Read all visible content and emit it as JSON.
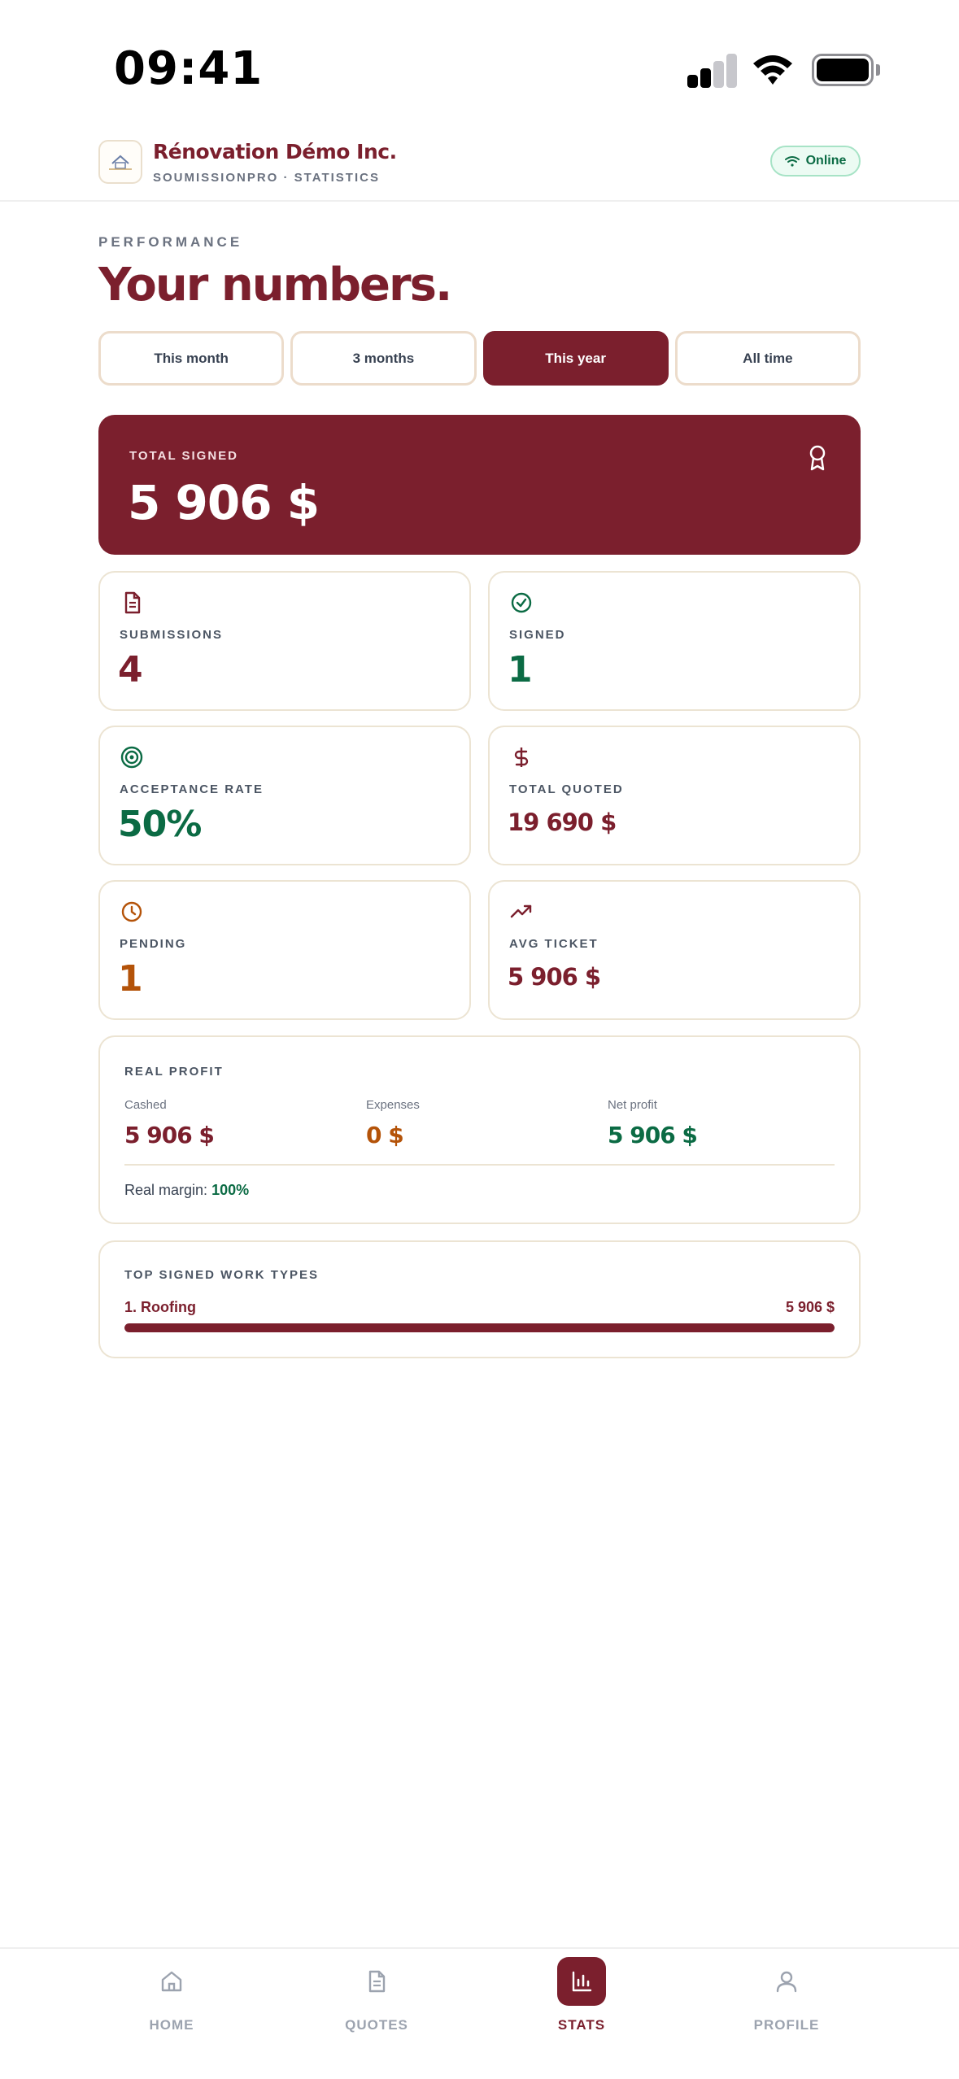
{
  "status_bar": {
    "time": "09:41"
  },
  "header": {
    "company_name": "Rénovation Démo Inc.",
    "subtitle": "SOUMISSIONPRO · STATISTICS",
    "status": "Online"
  },
  "page": {
    "eyebrow": "PERFORMANCE",
    "title": "Your numbers."
  },
  "period_tabs": [
    {
      "label": "This month",
      "active": false
    },
    {
      "label": "3 months",
      "active": false
    },
    {
      "label": "This year",
      "active": true
    },
    {
      "label": "All time",
      "active": false
    }
  ],
  "hero": {
    "label": "TOTAL SIGNED",
    "value": "5 906 $",
    "icon": "award-icon"
  },
  "stats": {
    "submissions": {
      "label": "SUBMISSIONS",
      "value": "4",
      "icon": "document-icon"
    },
    "signed": {
      "label": "SIGNED",
      "value": "1",
      "icon": "check-circle-icon"
    },
    "acceptance_rate": {
      "label": "ACCEPTANCE RATE",
      "value": "50%",
      "icon": "target-icon"
    },
    "total_quoted": {
      "label": "TOTAL QUOTED",
      "value": "19 690 $",
      "icon": "dollar-icon"
    },
    "pending": {
      "label": "PENDING",
      "value": "1",
      "icon": "clock-icon"
    },
    "avg_ticket": {
      "label": "AVG TICKET",
      "value": "5 906 $",
      "icon": "trending-up-icon"
    }
  },
  "profit": {
    "label": "REAL PROFIT",
    "cashed": {
      "label": "Cashed",
      "value": "5 906 $"
    },
    "expenses": {
      "label": "Expenses",
      "value": "0 $"
    },
    "net": {
      "label": "Net profit",
      "value": "5 906 $"
    },
    "margin_label": "Real margin:",
    "margin_value": "100%"
  },
  "work_types": {
    "label": "TOP SIGNED WORK TYPES",
    "items": [
      {
        "name": "1. Roofing",
        "amount": "5 906 $",
        "share": 1.0
      }
    ]
  },
  "bottom_nav": [
    {
      "label": "HOME",
      "icon": "home-icon",
      "active": false
    },
    {
      "label": "QUOTES",
      "icon": "document-icon",
      "active": false
    },
    {
      "label": "STATS",
      "icon": "bar-chart-icon",
      "active": true
    },
    {
      "label": "PROFILE",
      "icon": "user-icon",
      "active": false
    }
  ],
  "colors": {
    "brand": "#7b1f2d",
    "success": "#0b6b44",
    "warning": "#b45309",
    "border": "#ece4d3"
  }
}
